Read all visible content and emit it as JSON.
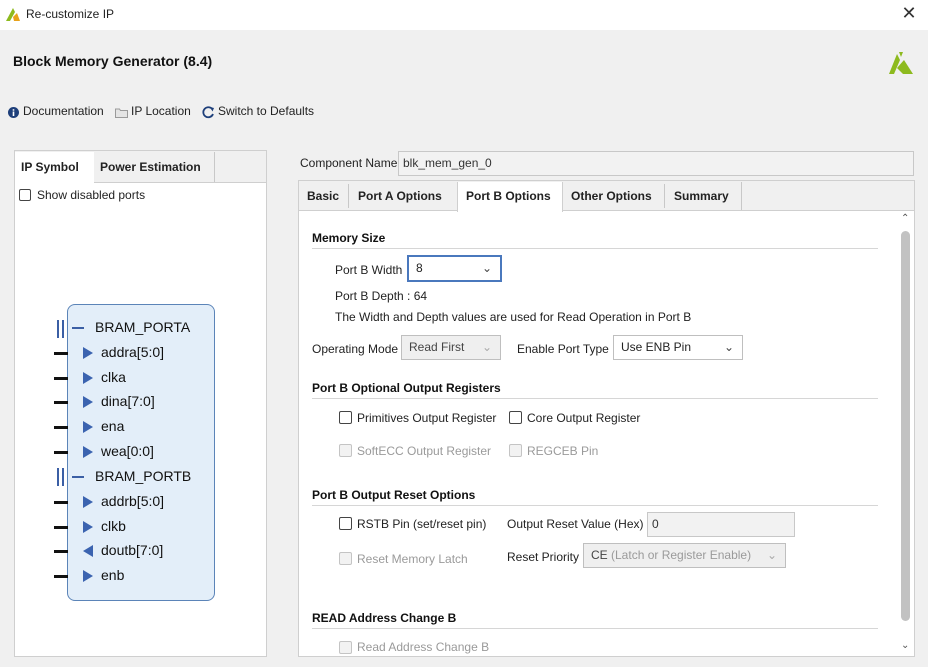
{
  "window": {
    "title": "Re-customize IP",
    "close": "✕"
  },
  "header": {
    "title": "Block Memory Generator (8.4)"
  },
  "toolbar": {
    "documentation": "Documentation",
    "ip_location": "IP Location",
    "switch_defaults": "Switch to Defaults"
  },
  "left_tabs": [
    "IP Symbol",
    "Power Estimation"
  ],
  "show_disabled_ports": "Show disabled ports",
  "symbol": {
    "porta_label": "BRAM_PORTA",
    "porta_pins": [
      "addra[5:0]",
      "clka",
      "dina[7:0]",
      "ena",
      "wea[0:0]"
    ],
    "portb_label": "BRAM_PORTB",
    "portb_pins": [
      "addrb[5:0]",
      "clkb",
      "doutb[7:0]",
      "enb"
    ]
  },
  "component": {
    "label": "Component Name",
    "value": "blk_mem_gen_0"
  },
  "tabs": [
    "Basic",
    "Port A Options",
    "Port B Options",
    "Other Options",
    "Summary"
  ],
  "active_tab": "Port B Options",
  "memory_size": {
    "heading": "Memory Size",
    "width_label": "Port B Width",
    "width_value": "8",
    "depth_text": "Port B Depth : 64",
    "note": "The Width and Depth values are used for Read Operation in Port B",
    "op_mode_label": "Operating Mode",
    "op_mode_value": "Read First",
    "enable_label": "Enable Port Type",
    "enable_value": "Use ENB Pin"
  },
  "optional_regs": {
    "heading": "Port B Optional Output Registers",
    "primitives": "Primitives Output Register",
    "core": "Core Output Register",
    "softecc": "SoftECC Output Register",
    "regceb": "REGCEB Pin"
  },
  "reset_options": {
    "heading": "Port B Output Reset Options",
    "rstb": "RSTB Pin (set/reset pin)",
    "reset_value_label": "Output Reset Value (Hex)",
    "reset_value": "0",
    "reset_latch": "Reset Memory Latch",
    "priority_label": "Reset Priority",
    "priority_value": "CE",
    "priority_hint": "(Latch or Register Enable)"
  },
  "read_addr": {
    "heading": "READ Address Change B",
    "checkbox": "Read Address Change B"
  },
  "colors": {
    "accent": "#3b63b0",
    "symbol_fill": "#e3eef9",
    "symbol_border": "#5b84b8",
    "logo": "#8dba1e"
  }
}
